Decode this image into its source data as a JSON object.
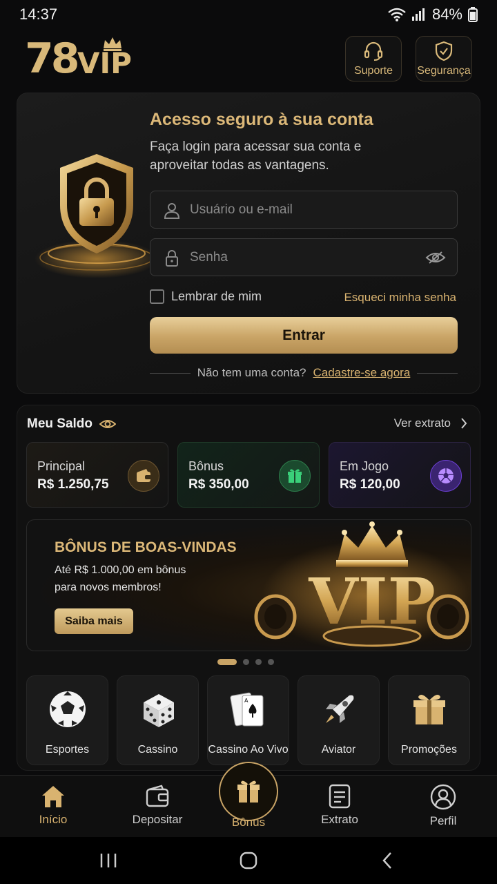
{
  "status": {
    "time": "14:37",
    "battery": "84%"
  },
  "header": {
    "logo_number": "78",
    "logo_vip": "VIP",
    "support_label": "Suporte",
    "security_label": "Segurança"
  },
  "login": {
    "title": "Acesso seguro à sua conta",
    "subtitle": "Faça login para acessar sua conta e aproveitar todas as vantagens.",
    "username_placeholder": "Usuário ou e-mail",
    "password_placeholder": "Senha",
    "remember_label": "Lembrar de mim",
    "forgot_label": "Esqueci minha senha",
    "submit_label": "Entrar",
    "no_account_text": "Não tem uma conta?",
    "signup_label": "Cadastre-se agora"
  },
  "balance": {
    "title": "Meu Saldo",
    "statement_link": "Ver extrato",
    "boxes": [
      {
        "label": "Principal",
        "value": "R$ 1.250,75",
        "icon": "wallet-icon"
      },
      {
        "label": "Bônus",
        "value": "R$ 350,00",
        "icon": "gift-icon"
      },
      {
        "label": "Em Jogo",
        "value": "R$ 120,00",
        "icon": "soccer-ball-icon"
      }
    ]
  },
  "banner": {
    "title": "BÔNUS DE BOAS-VINDAS",
    "line1": "Até R$ 1.000,00 em bônus",
    "line2": "para novos membros!",
    "button_label": "Saiba mais",
    "art_text": "VIP",
    "slides": 4,
    "active_slide": 1
  },
  "categories": [
    {
      "label": "Esportes",
      "icon": "soccer-ball-icon"
    },
    {
      "label": "Cassino",
      "icon": "dice-icon"
    },
    {
      "label": "Cassino Ao Vivo",
      "icon": "cards-icon"
    },
    {
      "label": "Aviator",
      "icon": "rocket-icon"
    },
    {
      "label": "Promoções",
      "icon": "gift-icon"
    }
  ],
  "bottom_nav": {
    "home": "Início",
    "deposit": "Depositar",
    "bonus": "Bônus",
    "statement": "Extrato",
    "profile": "Perfil"
  },
  "colors": {
    "accent": "#d9b370",
    "background": "#0b0b0c",
    "bonus_green": "#1f8a4c",
    "ingame_purple": "#6b3fd1"
  }
}
